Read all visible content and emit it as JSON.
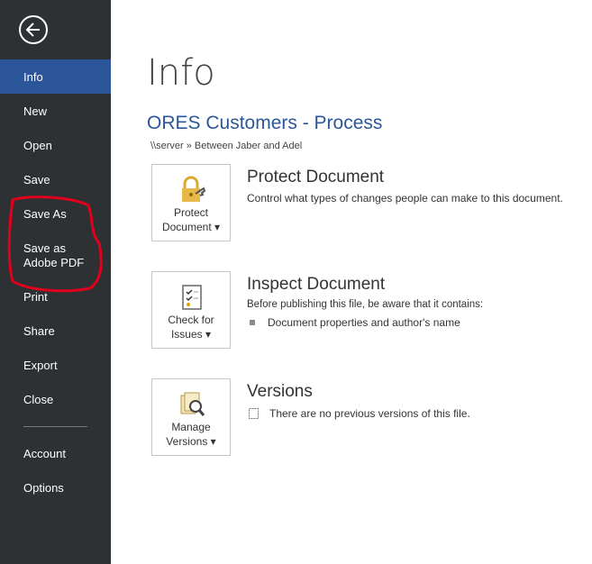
{
  "sidebar": {
    "items": [
      {
        "label": "Info",
        "active": true
      },
      {
        "label": "New"
      },
      {
        "label": "Open"
      },
      {
        "label": "Save"
      },
      {
        "label": "Save As"
      },
      {
        "label": "Save as Adobe PDF"
      },
      {
        "label": "Print"
      },
      {
        "label": "Share"
      },
      {
        "label": "Export"
      },
      {
        "label": "Close"
      },
      {
        "label": "Account"
      },
      {
        "label": "Options"
      }
    ]
  },
  "main": {
    "title": "Info",
    "doc_title": "ORES Customers - Process",
    "path": "\\\\server » Between Jaber and Adel",
    "protect": {
      "button_line1": "Protect",
      "button_line2": "Document ▾",
      "heading": "Protect Document",
      "text": "Control what types of changes people can make to this document."
    },
    "inspect": {
      "button_line1": "Check for",
      "button_line2": "Issues ▾",
      "heading": "Inspect Document",
      "text": "Before publishing this file, be aware that it contains:",
      "bullet": "Document properties and author's name"
    },
    "versions": {
      "button_line1": "Manage",
      "button_line2": "Versions ▾",
      "heading": "Versions",
      "text": "There are no previous versions of this file."
    }
  },
  "colors": {
    "sidebar_bg": "#2e3134",
    "active_bg": "#2b579a",
    "accent": "#2b579a",
    "annotation": "#e0001b"
  }
}
